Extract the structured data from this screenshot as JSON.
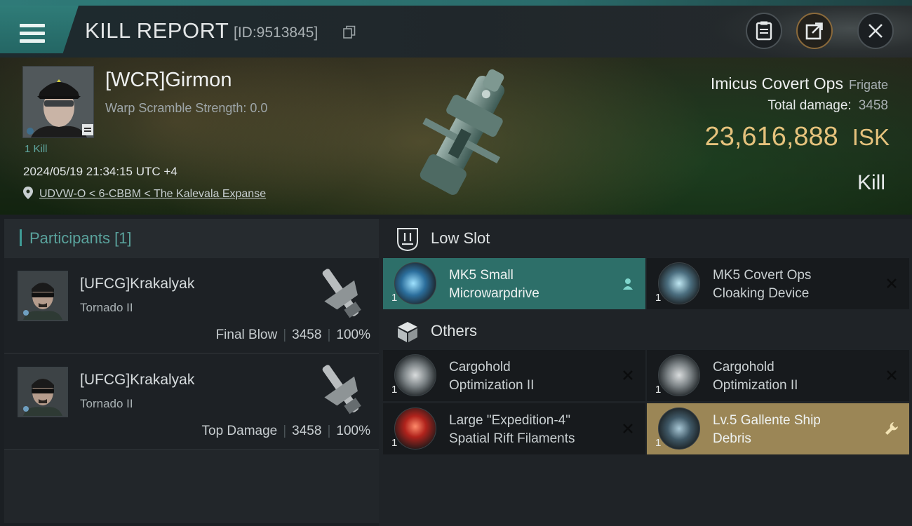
{
  "header": {
    "title": "KILL REPORT",
    "report_id": "[ID:9513845]"
  },
  "victim": {
    "name": "[WCR]Girmon",
    "warp_scramble": "Warp Scramble Strength: 0.0",
    "kill_count": "1 Kill",
    "datetime": "2024/05/19 21:34:15 UTC +4",
    "location": "UDVW-O < 6-CBBM < The Kalevala Expanse"
  },
  "ship": {
    "name": "Imicus Covert Ops",
    "class": "Frigate",
    "total_damage_label": "Total damage:",
    "total_damage_value": "3458",
    "isk_value": "23,616,888",
    "isk_unit": "ISK",
    "result": "Kill"
  },
  "participants": {
    "title": "Participants",
    "count": "[1]",
    "rows": [
      {
        "name": "[UFCG]Krakalyak",
        "ship": "Tornado II",
        "role": "Final Blow",
        "damage": "3458",
        "percent": "100%"
      },
      {
        "name": "[UFCG]Krakalyak",
        "ship": "Tornado II",
        "role": "Top Damage",
        "damage": "3458",
        "percent": "100%"
      }
    ]
  },
  "sections": {
    "low_slot": "Low Slot",
    "others": "Others"
  },
  "items": [
    {
      "qty": "1",
      "line1": "MK5 Small",
      "line2": "Microwarpdrive",
      "status": "person-icon"
    },
    {
      "qty": "1",
      "line1": "MK5 Covert Ops",
      "line2": "Cloaking Device",
      "status": "close-icon"
    },
    {
      "qty": "1",
      "line1": "Cargohold",
      "line2": "Optimization II",
      "status": "close-icon"
    },
    {
      "qty": "1",
      "line1": "Cargohold",
      "line2": "Optimization II",
      "status": "close-icon"
    },
    {
      "qty": "1",
      "line1": "Large \"Expedition-4\"",
      "line2": "Spatial Rift Filaments",
      "status": "close-icon"
    },
    {
      "qty": "1",
      "line1": "Lv.5 Gallente Ship",
      "line2": "Debris",
      "status": "wrench-icon"
    }
  ],
  "colors": {
    "accent_teal": "#2d6f69",
    "isk_gold": "#e5c27c",
    "highlight_gold": "#9b8656"
  }
}
